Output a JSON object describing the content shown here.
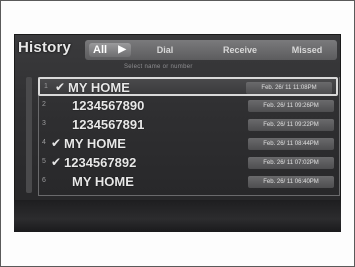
{
  "screen": {
    "title": "History",
    "subtitle": "Select name or number"
  },
  "tabs": [
    {
      "label": "All",
      "selected": true
    },
    {
      "label": "Dial",
      "selected": false
    },
    {
      "label": "Receive",
      "selected": false
    },
    {
      "label": "Missed",
      "selected": false
    }
  ],
  "entries": [
    {
      "index": "1",
      "icon": "speed-dial-icon",
      "name": "MY HOME",
      "date": "Feb. 26/ 11 11:08PM",
      "selected": true
    },
    {
      "index": "2",
      "icon": "",
      "name": "1234567890",
      "date": "Feb. 26/ 11 09:26PM",
      "selected": false
    },
    {
      "index": "3",
      "icon": "",
      "name": "1234567891",
      "date": "Feb. 26/ 11 09:22PM",
      "selected": false
    },
    {
      "index": "4",
      "icon": "speed-dial-icon",
      "name": "MY HOME",
      "date": "Feb. 26/ 11 08:44PM",
      "selected": false
    },
    {
      "index": "5",
      "icon": "speed-dial-icon",
      "name": "1234567892",
      "date": "Feb. 26/ 11 07:02PM",
      "selected": false
    },
    {
      "index": "6",
      "icon": "",
      "name": "MY HOME",
      "date": "Feb. 26/ 11 06:40PM",
      "selected": false
    }
  ]
}
